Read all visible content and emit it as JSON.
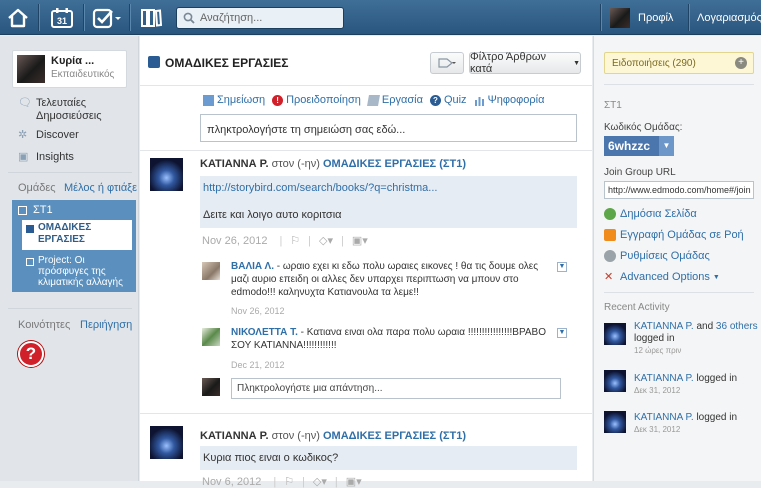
{
  "topbar": {
    "search_placeholder": "Αναζήτηση...",
    "calendar_day": "31",
    "profile_label": "Προφίλ",
    "account_label": "Λογαριασμός"
  },
  "left": {
    "profile_name": "Κυρία ...",
    "profile_role": "Εκπαιδευτικός",
    "nav": [
      "Τελευταίες Δημοσιεύσεις",
      "Discover",
      "Insights"
    ],
    "groups_heading": "Ομάδες",
    "groups_join": "Μέλος ή  φτιάξε",
    "group_st1": "ΣΤ1",
    "subgroup_codes": "ΟΜΑΔΙΚΕΣ ΕΡΓΑΣΙΕΣ",
    "subgroup_project": "Project: Οι πρόσφυγες της κλιματικής αλλαγής",
    "communities": "Κοινότητες",
    "browse": "Περιήγηση"
  },
  "center": {
    "title": "ΟΜΑΔΙΚΕΣ ΕΡΓΑΣΙΕΣ",
    "filter_label": "Φίλτρο Άρθρων κατά",
    "composer_tabs": [
      "Σημείωση",
      "Προειδοποίηση",
      "Εργασία",
      "Quiz",
      "Ψηφοφορία"
    ],
    "composer_placeholder": "πληκτρολογήστε τη σημειώση σας εδώ...",
    "post1": {
      "author": "ΚΑΤΙΑΝΝΑ Ρ.",
      "to": "στον (-ην)",
      "group": "ΟΜΑΔΙΚΕΣ ΕΡΓΑΣΙΕΣ (ΣΤ1)",
      "link": "http://storybird.com/search/books/?q=christma...",
      "text": "Δειτε και λοιγο αυτο κοριτσια",
      "date": "Nov 26, 2012"
    },
    "reply1": {
      "author": "ΒΑΛΙΑ Λ.",
      "text": "- ωραιο εχει κι εδω πολυ ωραιες εικονες ! θα τις δουμε ολες μαζι αυριο επειδη οι αλλες δεν υπαρχει περιπτωση να μπουν στο edmodo!!! καληνυχτα Κατιανουλα τα λεμε!!",
      "date": "Nov 26, 2012"
    },
    "reply2": {
      "author": "ΝΙΚΟΛΕΤΤΑ Τ.",
      "text": "- Κατιανα ειναι ολα παρα πολυ ωραια !!!!!!!!!!!!!!!!ΒΡΑΒΟ ΣΟΥ ΚΑΤΙΑΝΝΑ!!!!!!!!!!!!",
      "date": "Dec 21, 2012"
    },
    "reply_placeholder": "Πληκτρολογήστε μια απάντηση...",
    "post2": {
      "author": "ΚΑΤΙΑΝΝΑ Ρ.",
      "to": "στον (-ην)",
      "group": "ΟΜΑΔΙΚΕΣ ΕΡΓΑΣΙΕΣ (ΣΤ1)",
      "text": "Κυρια πιος ειναι ο κωδικος?",
      "date": "Nov 6, 2012"
    }
  },
  "right": {
    "notifications": "Ειδοποιήσεις (290)",
    "group_name": "ΣΤ1",
    "group_code_label": "Κωδικός Ομάδας:",
    "group_code": "6whzzc",
    "join_url_label": "Join Group URL",
    "join_url": "http://www.edmodo.com/home#/join",
    "links": [
      "Δημόσια Σελίδα",
      "Εγγραφή Ομάδας σε Ροή",
      "Ρυθμίσεις Ομάδας",
      "Advanced Options"
    ],
    "recent_title": "Recent Activity",
    "activity": [
      {
        "name": "ΚΑΤΙΑΝΝΑ Ρ.",
        "and": "and",
        "others": "36 others",
        "action": "logged in",
        "time": "12 ώρες πριν"
      },
      {
        "name": "ΚΑΤΙΑΝΝΑ Ρ.",
        "action": "logged in",
        "time": "Δεκ 31, 2012"
      },
      {
        "name": "ΚΑΤΙΑΝΝΑ Ρ.",
        "action": "logged in",
        "time": "Δεκ 31, 2012"
      }
    ]
  },
  "colors": {
    "topbar": "#2f5d87",
    "link": "#2f6fa8",
    "group_highlight": "#5b8fbd",
    "code_bg": "#4a76ad",
    "help": "#d0202a"
  }
}
